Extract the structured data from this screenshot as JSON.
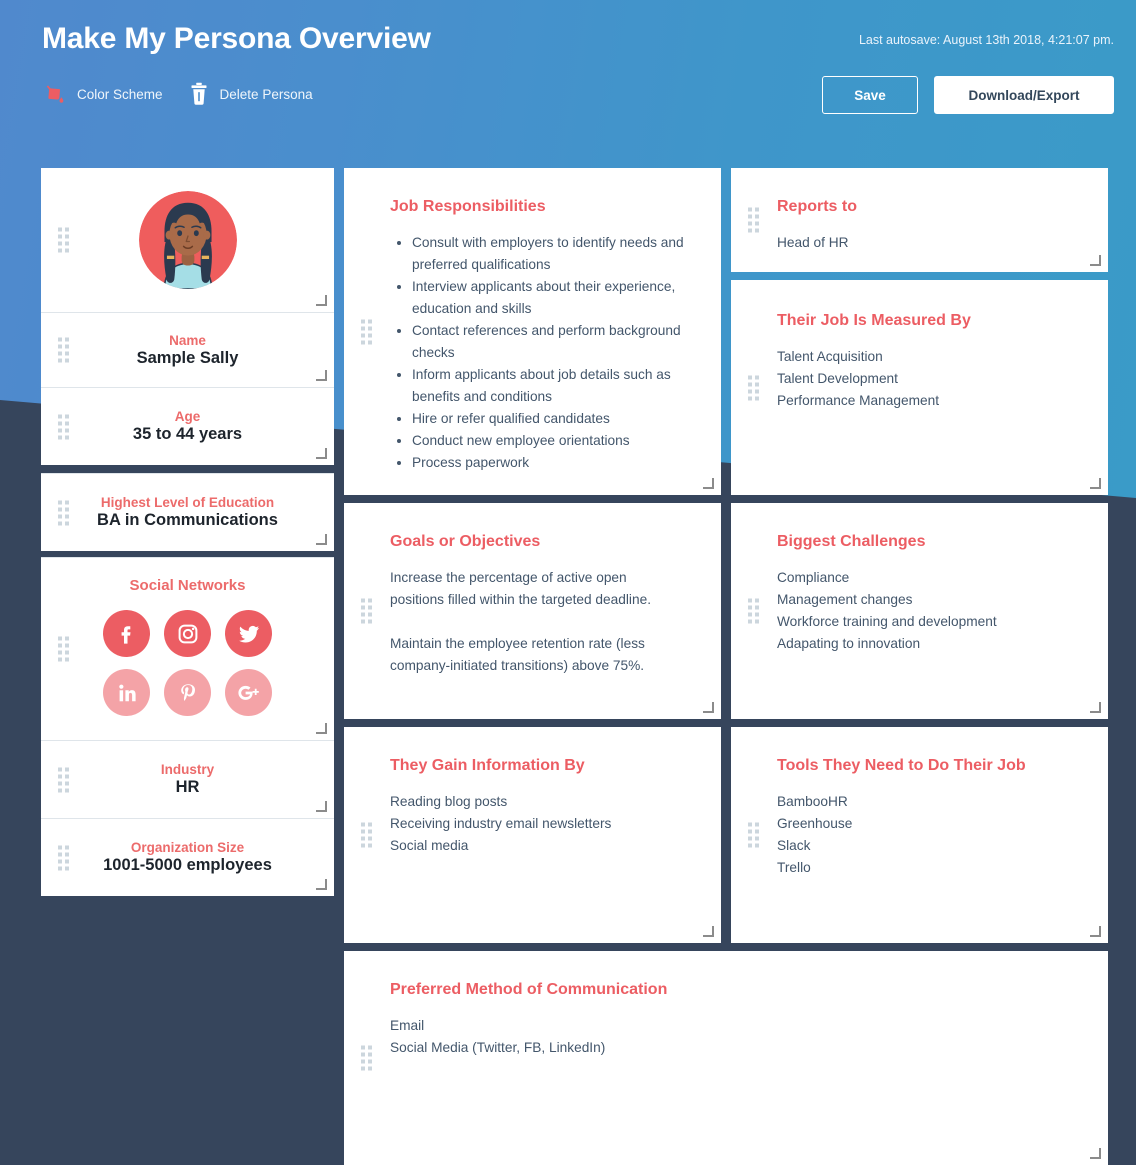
{
  "header": {
    "title": "Make My Persona Overview",
    "autosave": "Last autosave: August 13th 2018, 4:21:07 pm.",
    "color_scheme_label": "Color Scheme",
    "delete_persona_label": "Delete Persona",
    "save_label": "Save",
    "download_export_label": "Download/Export"
  },
  "colors": {
    "accent_red": "#ec5d63",
    "accent_red_soft": "#f4a3a7",
    "header_blue_left": "#5089cd",
    "header_blue_right": "#3a9bc8",
    "background_navy": "#36455c",
    "text_dark": "#43566b",
    "card_white": "#ffffff"
  },
  "persona": {
    "avatar_alt": "persona-avatar",
    "fields": [
      {
        "label": "Name",
        "value": "Sample Sally"
      },
      {
        "label": "Age",
        "value": "35 to 44 years"
      },
      {
        "label": "Highest Level of Education",
        "value": "BA in Communications"
      },
      {
        "label": "Industry",
        "value": "HR"
      },
      {
        "label": "Organization Size",
        "value": "1001-5000 employees"
      }
    ],
    "social": {
      "title": "Social Networks",
      "networks": [
        {
          "name": "facebook",
          "icon": "facebook-icon",
          "active": true
        },
        {
          "name": "instagram",
          "icon": "instagram-icon",
          "active": true
        },
        {
          "name": "twitter",
          "icon": "twitter-icon",
          "active": true
        },
        {
          "name": "linkedin",
          "icon": "linkedin-icon",
          "active": false
        },
        {
          "name": "pinterest",
          "icon": "pinterest-icon",
          "active": false
        },
        {
          "name": "googleplus",
          "icon": "google-plus-icon",
          "active": false
        }
      ]
    }
  },
  "cards": {
    "job_responsibilities": {
      "title": "Job Responsibilities",
      "items": [
        "Consult with employers to identify needs and preferred qualifications",
        "Interview applicants about their experience, education and skills",
        "Contact references and perform background checks",
        "Inform applicants about job details such as benefits and conditions",
        "Hire or refer qualified candidates",
        "Conduct new employee orientations",
        "Process paperwork"
      ]
    },
    "reports_to": {
      "title": "Reports to",
      "items": [
        "Head of HR"
      ]
    },
    "measured_by": {
      "title": "Their Job Is Measured By",
      "items": [
        "Talent Acquisition",
        "Talent Development",
        "Performance Management"
      ]
    },
    "goals": {
      "title": "Goals or Objectives",
      "paragraphs": [
        "Increase the percentage of active open positions filled within the targeted deadline.",
        "Maintain the employee retention rate (less company-initiated transitions) above 75%."
      ]
    },
    "challenges": {
      "title": "Biggest Challenges",
      "items": [
        "Compliance",
        "Management changes",
        "Workforce training and development",
        "Adapating to innovation"
      ]
    },
    "information": {
      "title": "They Gain Information By",
      "items": [
        "Reading blog posts",
        "Receiving industry email newsletters",
        "Social media"
      ]
    },
    "tools": {
      "title": "Tools They Need to Do Their Job",
      "items": [
        "BambooHR",
        "Greenhouse",
        "Slack",
        "Trello"
      ]
    },
    "communication": {
      "title": "Preferred Method of Communication",
      "items": [
        "Email",
        "Social Media (Twitter, FB, LinkedIn)"
      ]
    }
  }
}
